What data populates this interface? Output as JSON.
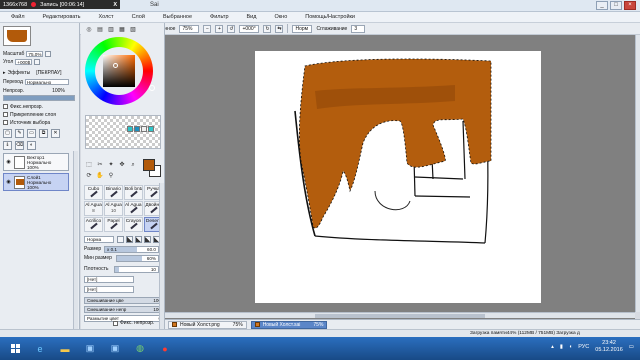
{
  "titlebar": {
    "recorder_resolution": "1366x768",
    "recorder_status": "Запись [00:06:14]",
    "recorder_close": "X",
    "app_title": "Sai"
  },
  "menu": [
    "Файл",
    "Редактировать",
    "Холст",
    "Слой",
    "Выбранное",
    "Фильтр",
    "Вид",
    "Окно",
    "Помощь/Настройки"
  ],
  "toolbar": {
    "selected_label": "Выбранное",
    "zoom": "75%",
    "rotation": "+000°",
    "blend_mode": "Норм",
    "stabilizer_label": "Сглаживание",
    "stabilizer_value": "3"
  },
  "navigator": {
    "zoom_label": "Масштаб",
    "zoom_value": "75.0%",
    "angle_label": "Угол",
    "angle_value": "+000$"
  },
  "layer_panel": {
    "effects_label": "Эффекты",
    "effects_value": "[ПЕКРЛАУ]",
    "mode_label": "Переход",
    "mode_value": "Нормально",
    "opacity_label": "Непрозр.",
    "opacity_value": "100%",
    "opacity_fill": 1.0,
    "checkboxes": [
      "Фикс.непрозр.",
      "Прикрепление слоя",
      "Источник выбора"
    ],
    "layers": [
      {
        "name": "Вектор1",
        "mode": "Нормально",
        "opacity": "100%",
        "selected": false
      },
      {
        "name": "Слой1",
        "mode": "Нормально",
        "opacity": "100%",
        "selected": true
      }
    ]
  },
  "tools": {
    "cells": [
      {
        "name": "Cubo",
        "num": ""
      },
      {
        "name": "Binario",
        "num": ""
      },
      {
        "name": "Boli bnta",
        "num": ""
      },
      {
        "name": "Ручка",
        "num": ""
      },
      {
        "name": "Al Agua",
        "num": "8"
      },
      {
        "name": "Al Agua",
        "num": "10"
      },
      {
        "name": "Al Agua Gr",
        "num": ""
      },
      {
        "name": "Двойнь",
        "num": ""
      },
      {
        "name": "Acrilico",
        "num": ""
      },
      {
        "name": "Papel",
        "num": ""
      },
      {
        "name": "Crayon",
        "num": ""
      },
      {
        "name": "Desenf",
        "num": ""
      }
    ],
    "mode_label": "Норма",
    "size_label": "Размер",
    "size_mult": "x 0.1",
    "size_value": "60.0",
    "min_size_label": "Мин размер",
    "min_size_value": "60%",
    "density_label": "Плотность",
    "density_value": "10",
    "shape_none_1": "[Нет]",
    "shape_none_2": "[Нет]",
    "mix_label_1": "Смешивание цве",
    "mix_value_1": "100",
    "mix_label_2": "Смешивание непр",
    "mix_value_2": "100",
    "mix_label_3": "Размытие цвет",
    "mix_value_3": "0",
    "keep_opacity": "Фикс. непрозр."
  },
  "colors": {
    "foreground": "#b25a0a",
    "background": "#ffffff",
    "paint": "#b35d0d",
    "paint_dark": "#7a3a06",
    "swatches": [
      "#2fc4c8",
      "#1e8fbf",
      "#f0f0f0",
      "#2fc4c8"
    ]
  },
  "tabs": [
    {
      "name": "Новый Холст.png",
      "zoom": "75%",
      "active": false
    },
    {
      "name": "Новый Холст.sai",
      "zoom": "75%",
      "active": true
    }
  ],
  "status": {
    "memory": "Загрузка памяти44% (112MB / 751MB)  Загрузка д"
  },
  "taskbar": {
    "lang": "РУС",
    "time": "23:42",
    "date": "05.12.2016",
    "icons": [
      "start-icon",
      "ie-icon",
      "explorer-icon",
      "video-icon",
      "video-icon",
      "chrome-icon",
      "record-icon"
    ]
  }
}
